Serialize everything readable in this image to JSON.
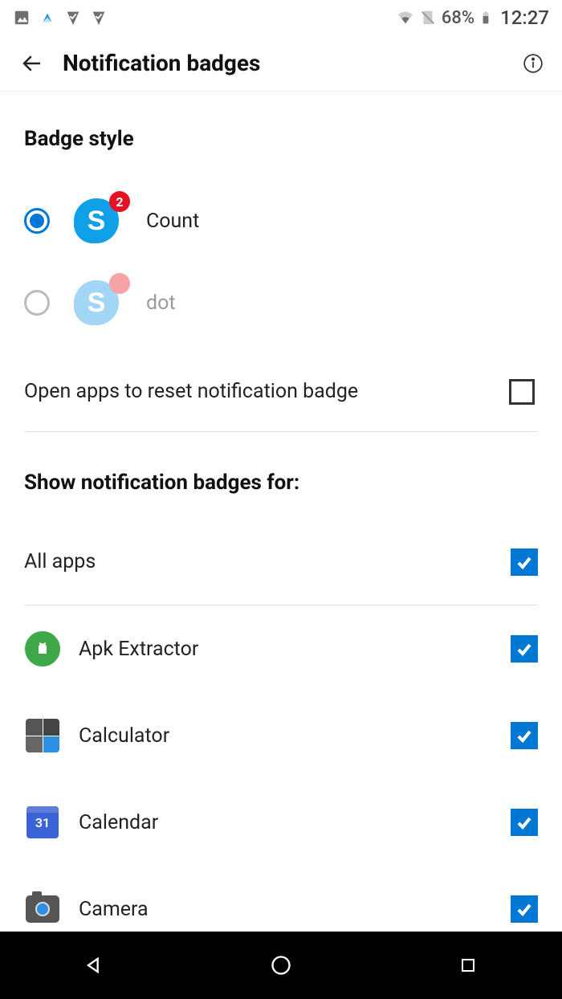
{
  "status": {
    "battery_pct": "68%",
    "time": "12:27"
  },
  "header": {
    "title": "Notification badges"
  },
  "badge_style": {
    "title": "Badge style",
    "count_label": "Count",
    "count_badge_value": "2",
    "dot_label": "dot",
    "selected": "count"
  },
  "reset_row": {
    "label": "Open apps to reset notification badge",
    "checked": false
  },
  "list": {
    "title": "Show notification badges for:",
    "all_apps_label": "All apps",
    "all_apps_checked": true,
    "apps": [
      {
        "name": "Apk Extractor",
        "checked": true,
        "icon": "android"
      },
      {
        "name": "Calculator",
        "checked": true,
        "icon": "calculator"
      },
      {
        "name": "Calendar",
        "checked": true,
        "icon": "calendar",
        "day": "31"
      },
      {
        "name": "Camera",
        "checked": true,
        "icon": "camera"
      }
    ]
  }
}
